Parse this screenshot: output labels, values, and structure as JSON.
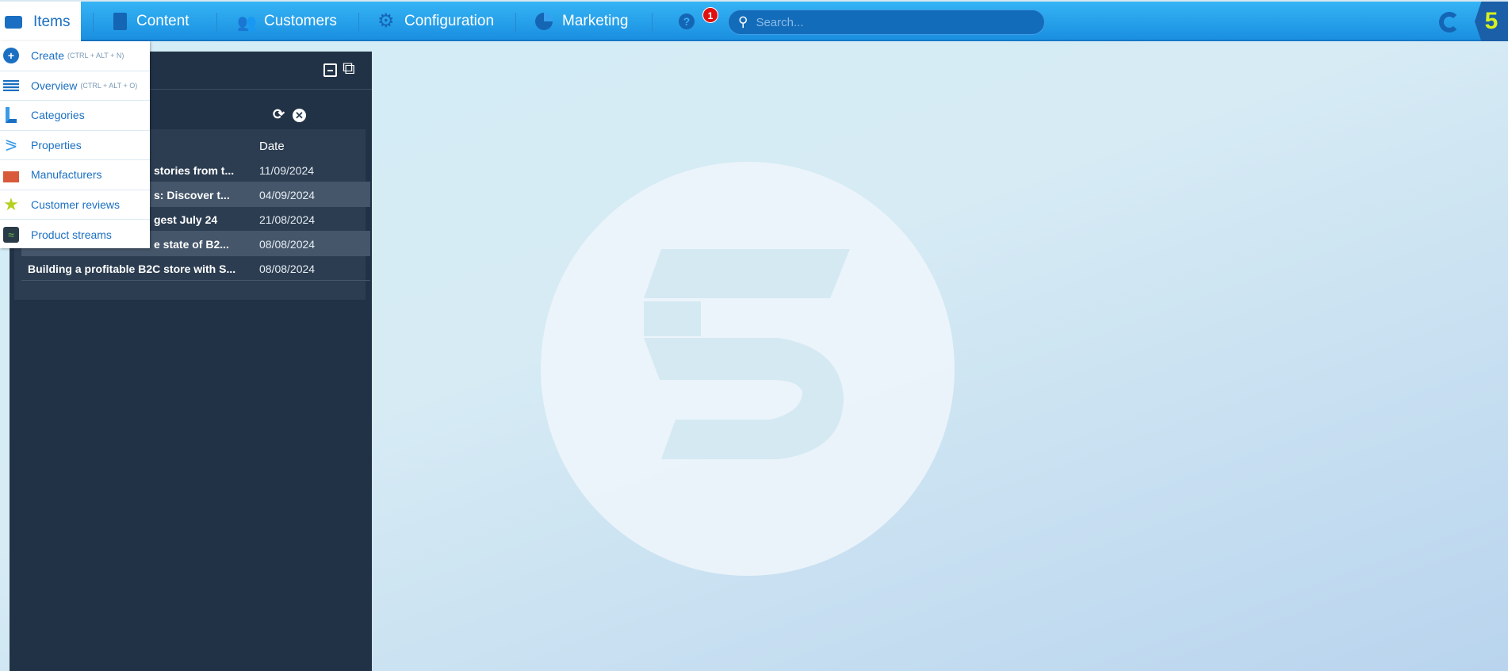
{
  "nav": {
    "items": "Items",
    "content": "Content",
    "customers": "Customers",
    "configuration": "Configuration",
    "marketing": "Marketing",
    "notification_count": "1",
    "search_placeholder": "Search..."
  },
  "menu": [
    {
      "label": "Create",
      "shortcut": "(CTRL + ALT + N)",
      "icon": "plus-circle-icon"
    },
    {
      "label": "Overview",
      "shortcut": "(CTRL + ALT + O)",
      "icon": "list-icon"
    },
    {
      "label": "Categories",
      "shortcut": "",
      "icon": "tree-icon"
    },
    {
      "label": "Properties",
      "shortcut": "",
      "icon": "share-icon"
    },
    {
      "label": "Manufacturers",
      "shortcut": "",
      "icon": "factory-icon"
    },
    {
      "label": "Customer reviews",
      "shortcut": "",
      "icon": "star-icon"
    },
    {
      "label": "Product streams",
      "shortcut": "",
      "icon": "streams-icon"
    }
  ],
  "widget": {
    "date_header": "Date",
    "rows": [
      {
        "title": "stories from t...",
        "date": "11/09/2024"
      },
      {
        "title": "s: Discover t...",
        "date": "04/09/2024"
      },
      {
        "title": "gest July 24",
        "date": "21/08/2024"
      },
      {
        "title": "e state of B2...",
        "date": "08/08/2024"
      },
      {
        "title": "Building a profitable B2C store with S...",
        "date": "08/08/2024"
      }
    ]
  },
  "colors": {
    "topbar": "#1a8fe0",
    "panel": "#223246",
    "accent": "#1a6fc2",
    "logo": "#d8f020"
  }
}
